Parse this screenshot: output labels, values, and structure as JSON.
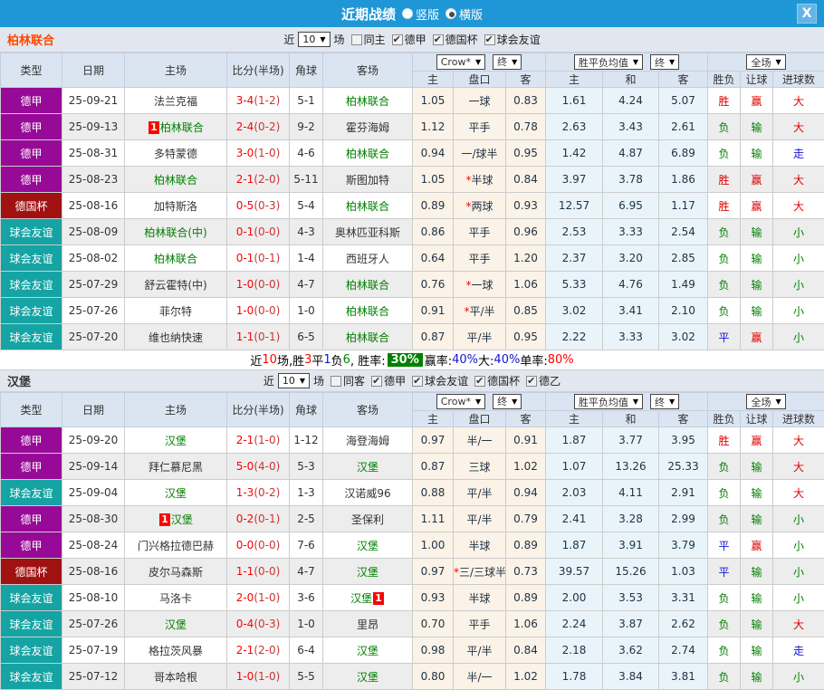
{
  "titlebar": {
    "title": "近期战绩",
    "options": [
      {
        "label": "竖版",
        "selected": false
      },
      {
        "label": "横版",
        "selected": true
      }
    ],
    "close_label": "X"
  },
  "layout_labels": {
    "left_columns": [
      "类型",
      "日期",
      "主场",
      "比分(半场)",
      "角球",
      "客场"
    ],
    "crow_select": "Crow*",
    "crow_final": "终",
    "crow_columns": [
      "主",
      "盘口",
      "客"
    ],
    "euro_select": "胜平负均值",
    "euro_final": "终",
    "euro_columns": [
      "主",
      "和",
      "客"
    ],
    "full_select": "全场",
    "full_columns": [
      "胜负",
      "让球",
      "进球数"
    ]
  },
  "type_colors": {
    "德甲": "#970a97",
    "德国杯": "#a01212",
    "球会友谊": "#15a3a3"
  },
  "result_colors": {
    "胜": "#e00000",
    "平": "#1414d2",
    "负": "#008000",
    "赢": "#e00000",
    "输": "#008000",
    "大": "#e00000",
    "小": "#008000",
    "走": "#1414d2"
  },
  "sections": [
    {
      "team": "柏林联合",
      "team_color": "#ff4800",
      "filters": {
        "near": "近",
        "count": "10",
        "unit": "场",
        "same": {
          "label": "同主",
          "checked": false
        },
        "leagues": [
          {
            "label": "德甲",
            "checked": true
          },
          {
            "label": "德国杯",
            "checked": true
          },
          {
            "label": "球会友谊",
            "checked": true
          }
        ]
      },
      "rows": [
        {
          "type": "德甲",
          "date": "25-09-21",
          "home": "法兰克福",
          "home_green": false,
          "home_badge": "",
          "score": "3-4",
          "half": "(1-2)",
          "corners": "5-1",
          "away": "柏林联合",
          "away_green": true,
          "away_badge": "",
          "crow_home": "1.05",
          "star": false,
          "handicap": "一球",
          "crow_away": "0.83",
          "euro_home": "1.61",
          "euro_draw": "4.24",
          "euro_away": "5.07",
          "result": "胜",
          "handicap_result": "赢",
          "goals": "大"
        },
        {
          "type": "德甲",
          "date": "25-09-13",
          "home": "柏林联合",
          "home_green": true,
          "home_badge": "1",
          "score": "2-4",
          "half": "(0-2)",
          "corners": "9-2",
          "away": "霍芬海姆",
          "away_green": false,
          "away_badge": "",
          "crow_home": "1.12",
          "star": false,
          "handicap": "平手",
          "crow_away": "0.78",
          "euro_home": "2.63",
          "euro_draw": "3.43",
          "euro_away": "2.61",
          "result": "负",
          "handicap_result": "输",
          "goals": "大"
        },
        {
          "type": "德甲",
          "date": "25-08-31",
          "home": "多特蒙德",
          "home_green": false,
          "home_badge": "",
          "score": "3-0",
          "half": "(1-0)",
          "corners": "4-6",
          "away": "柏林联合",
          "away_green": true,
          "away_badge": "",
          "crow_home": "0.94",
          "star": false,
          "handicap": "一/球半",
          "crow_away": "0.95",
          "euro_home": "1.42",
          "euro_draw": "4.87",
          "euro_away": "6.89",
          "result": "负",
          "handicap_result": "输",
          "goals": "走"
        },
        {
          "type": "德甲",
          "date": "25-08-23",
          "home": "柏林联合",
          "home_green": true,
          "home_badge": "",
          "score": "2-1",
          "half": "(2-0)",
          "corners": "5-11",
          "away": "斯图加特",
          "away_green": false,
          "away_badge": "",
          "crow_home": "1.05",
          "star": true,
          "handicap": "半球",
          "crow_away": "0.84",
          "euro_home": "3.97",
          "euro_draw": "3.78",
          "euro_away": "1.86",
          "result": "胜",
          "handicap_result": "赢",
          "goals": "大"
        },
        {
          "type": "德国杯",
          "date": "25-08-16",
          "home": "加特斯洛",
          "home_green": false,
          "home_badge": "",
          "score": "0-5",
          "half": "(0-3)",
          "corners": "5-4",
          "away": "柏林联合",
          "away_green": true,
          "away_badge": "",
          "crow_home": "0.89",
          "star": true,
          "handicap": "两球",
          "crow_away": "0.93",
          "euro_home": "12.57",
          "euro_draw": "6.95",
          "euro_away": "1.17",
          "result": "胜",
          "handicap_result": "赢",
          "goals": "大"
        },
        {
          "type": "球会友谊",
          "date": "25-08-09",
          "home": "柏林联合(中)",
          "home_green": true,
          "home_badge": "",
          "score": "0-1",
          "half": "(0-0)",
          "corners": "4-3",
          "away": "奥林匹亚科斯",
          "away_green": false,
          "away_badge": "",
          "crow_home": "0.86",
          "star": false,
          "handicap": "平手",
          "crow_away": "0.96",
          "euro_home": "2.53",
          "euro_draw": "3.33",
          "euro_away": "2.54",
          "result": "负",
          "handicap_result": "输",
          "goals": "小"
        },
        {
          "type": "球会友谊",
          "date": "25-08-02",
          "home": "柏林联合",
          "home_green": true,
          "home_badge": "",
          "score": "0-1",
          "half": "(0-1)",
          "corners": "1-4",
          "away": "西班牙人",
          "away_green": false,
          "away_badge": "",
          "crow_home": "0.64",
          "star": false,
          "handicap": "平手",
          "crow_away": "1.20",
          "euro_home": "2.37",
          "euro_draw": "3.20",
          "euro_away": "2.85",
          "result": "负",
          "handicap_result": "输",
          "goals": "小"
        },
        {
          "type": "球会友谊",
          "date": "25-07-29",
          "home": "舒云霍特(中)",
          "home_green": false,
          "home_badge": "",
          "score": "1-0",
          "half": "(0-0)",
          "corners": "4-7",
          "away": "柏林联合",
          "away_green": true,
          "away_badge": "",
          "crow_home": "0.76",
          "star": true,
          "handicap": "一球",
          "crow_away": "1.06",
          "euro_home": "5.33",
          "euro_draw": "4.76",
          "euro_away": "1.49",
          "result": "负",
          "handicap_result": "输",
          "goals": "小"
        },
        {
          "type": "球会友谊",
          "date": "25-07-26",
          "home": "菲尔特",
          "home_green": false,
          "home_badge": "",
          "score": "1-0",
          "half": "(0-0)",
          "corners": "1-0",
          "away": "柏林联合",
          "away_green": true,
          "away_badge": "",
          "crow_home": "0.91",
          "star": true,
          "handicap": "平/半",
          "crow_away": "0.85",
          "euro_home": "3.02",
          "euro_draw": "3.41",
          "euro_away": "2.10",
          "result": "负",
          "handicap_result": "输",
          "goals": "小"
        },
        {
          "type": "球会友谊",
          "date": "25-07-20",
          "home": "维也纳快速",
          "home_green": false,
          "home_badge": "",
          "score": "1-1",
          "half": "(0-1)",
          "corners": "6-5",
          "away": "柏林联合",
          "away_green": true,
          "away_badge": "",
          "crow_home": "0.87",
          "star": false,
          "handicap": "平/半",
          "crow_away": "0.95",
          "euro_home": "2.22",
          "euro_draw": "3.33",
          "euro_away": "3.02",
          "result": "平",
          "handicap_result": "赢",
          "goals": "小"
        }
      ],
      "summary": [
        {
          "text": "近",
          "color": "#000000"
        },
        {
          "text": "10",
          "color": "#ff0000"
        },
        {
          "text": "场,胜",
          "color": "#000000"
        },
        {
          "text": "3",
          "color": "#ff0000"
        },
        {
          "text": "平",
          "color": "#000000"
        },
        {
          "text": "1",
          "color": "#1414d2"
        },
        {
          "text": "负",
          "color": "#000000"
        },
        {
          "text": "6",
          "color": "#008000"
        },
        {
          "text": ", 胜率:",
          "color": "#000000"
        },
        {
          "text": "30%",
          "color": "#ffffff",
          "bg": "#008000"
        },
        {
          "text": " 赢率:",
          "color": "#000000"
        },
        {
          "text": "40%",
          "color": "#1414d2"
        },
        {
          "text": " 大:",
          "color": "#000000"
        },
        {
          "text": "40%",
          "color": "#1414d2"
        },
        {
          "text": " 单率:",
          "color": "#000000"
        },
        {
          "text": "80%",
          "color": "#ff0000"
        }
      ]
    },
    {
      "team": "汉堡",
      "team_color": "#333333",
      "filters": {
        "near": "近",
        "count": "10",
        "unit": "场",
        "same": {
          "label": "同客",
          "checked": false
        },
        "leagues": [
          {
            "label": "德甲",
            "checked": true
          },
          {
            "label": "球会友谊",
            "checked": true
          },
          {
            "label": "德国杯",
            "checked": true
          },
          {
            "label": "德乙",
            "checked": true
          }
        ]
      },
      "rows": [
        {
          "type": "德甲",
          "date": "25-09-20",
          "home": "汉堡",
          "home_green": true,
          "home_badge": "",
          "score": "2-1",
          "half": "(1-0)",
          "corners": "1-12",
          "away": "海登海姆",
          "away_green": false,
          "away_badge": "",
          "crow_home": "0.97",
          "star": false,
          "handicap": "半/一",
          "crow_away": "0.91",
          "euro_home": "1.87",
          "euro_draw": "3.77",
          "euro_away": "3.95",
          "result": "胜",
          "handicap_result": "赢",
          "goals": "大"
        },
        {
          "type": "德甲",
          "date": "25-09-14",
          "home": "拜仁慕尼黑",
          "home_green": false,
          "home_badge": "",
          "score": "5-0",
          "half": "(4-0)",
          "corners": "5-3",
          "away": "汉堡",
          "away_green": true,
          "away_badge": "",
          "crow_home": "0.87",
          "star": false,
          "handicap": "三球",
          "crow_away": "1.02",
          "euro_home": "1.07",
          "euro_draw": "13.26",
          "euro_away": "25.33",
          "result": "负",
          "handicap_result": "输",
          "goals": "大"
        },
        {
          "type": "球会友谊",
          "date": "25-09-04",
          "home": "汉堡",
          "home_green": true,
          "home_badge": "",
          "score": "1-3",
          "half": "(0-2)",
          "corners": "1-3",
          "away": "汉诺威96",
          "away_green": false,
          "away_badge": "",
          "crow_home": "0.88",
          "star": false,
          "handicap": "平/半",
          "crow_away": "0.94",
          "euro_home": "2.03",
          "euro_draw": "4.11",
          "euro_away": "2.91",
          "result": "负",
          "handicap_result": "输",
          "goals": "大"
        },
        {
          "type": "德甲",
          "date": "25-08-30",
          "home": "汉堡",
          "home_green": true,
          "home_badge": "1",
          "score": "0-2",
          "half": "(0-1)",
          "corners": "2-5",
          "away": "圣保利",
          "away_green": false,
          "away_badge": "",
          "crow_home": "1.11",
          "star": false,
          "handicap": "平/半",
          "crow_away": "0.79",
          "euro_home": "2.41",
          "euro_draw": "3.28",
          "euro_away": "2.99",
          "result": "负",
          "handicap_result": "输",
          "goals": "小"
        },
        {
          "type": "德甲",
          "date": "25-08-24",
          "home": "门兴格拉德巴赫",
          "home_green": false,
          "home_badge": "",
          "score": "0-0",
          "half": "(0-0)",
          "corners": "7-6",
          "away": "汉堡",
          "away_green": true,
          "away_badge": "",
          "crow_home": "1.00",
          "star": false,
          "handicap": "半球",
          "crow_away": "0.89",
          "euro_home": "1.87",
          "euro_draw": "3.91",
          "euro_away": "3.79",
          "result": "平",
          "handicap_result": "赢",
          "goals": "小"
        },
        {
          "type": "德国杯",
          "date": "25-08-16",
          "home": "皮尔马森斯",
          "home_green": false,
          "home_badge": "",
          "score": "1-1",
          "half": "(0-0)",
          "corners": "4-7",
          "away": "汉堡",
          "away_green": true,
          "away_badge": "",
          "crow_home": "0.97",
          "star": true,
          "handicap": "三/三球半",
          "crow_away": "0.73",
          "euro_home": "39.57",
          "euro_draw": "15.26",
          "euro_away": "1.03",
          "result": "平",
          "handicap_result": "输",
          "goals": "小"
        },
        {
          "type": "球会友谊",
          "date": "25-08-10",
          "home": "马洛卡",
          "home_green": false,
          "home_badge": "",
          "score": "2-0",
          "half": "(1-0)",
          "corners": "3-6",
          "away": "汉堡",
          "away_green": true,
          "away_badge": "1",
          "crow_home": "0.93",
          "star": false,
          "handicap": "半球",
          "crow_away": "0.89",
          "euro_home": "2.00",
          "euro_draw": "3.53",
          "euro_away": "3.31",
          "result": "负",
          "handicap_result": "输",
          "goals": "小"
        },
        {
          "type": "球会友谊",
          "date": "25-07-26",
          "home": "汉堡",
          "home_green": true,
          "home_badge": "",
          "score": "0-4",
          "half": "(0-3)",
          "corners": "1-0",
          "away": "里昂",
          "away_green": false,
          "away_badge": "",
          "crow_home": "0.70",
          "star": false,
          "handicap": "平手",
          "crow_away": "1.06",
          "euro_home": "2.24",
          "euro_draw": "3.87",
          "euro_away": "2.62",
          "result": "负",
          "handicap_result": "输",
          "goals": "大"
        },
        {
          "type": "球会友谊",
          "date": "25-07-19",
          "home": "格拉茨风暴",
          "home_green": false,
          "home_badge": "",
          "score": "2-1",
          "half": "(2-0)",
          "corners": "6-4",
          "away": "汉堡",
          "away_green": true,
          "away_badge": "",
          "crow_home": "0.98",
          "star": false,
          "handicap": "平/半",
          "crow_away": "0.84",
          "euro_home": "2.18",
          "euro_draw": "3.62",
          "euro_away": "2.74",
          "result": "负",
          "handicap_result": "输",
          "goals": "走"
        },
        {
          "type": "球会友谊",
          "date": "25-07-12",
          "home": "哥本哈根",
          "home_green": false,
          "home_badge": "",
          "score": "1-0",
          "half": "(1-0)",
          "corners": "5-5",
          "away": "汉堡",
          "away_green": true,
          "away_badge": "",
          "crow_home": "0.80",
          "star": false,
          "handicap": "半/一",
          "crow_away": "1.02",
          "euro_home": "1.78",
          "euro_draw": "3.84",
          "euro_away": "3.81",
          "result": "负",
          "handicap_result": "输",
          "goals": "小"
        }
      ],
      "summary": null
    }
  ]
}
